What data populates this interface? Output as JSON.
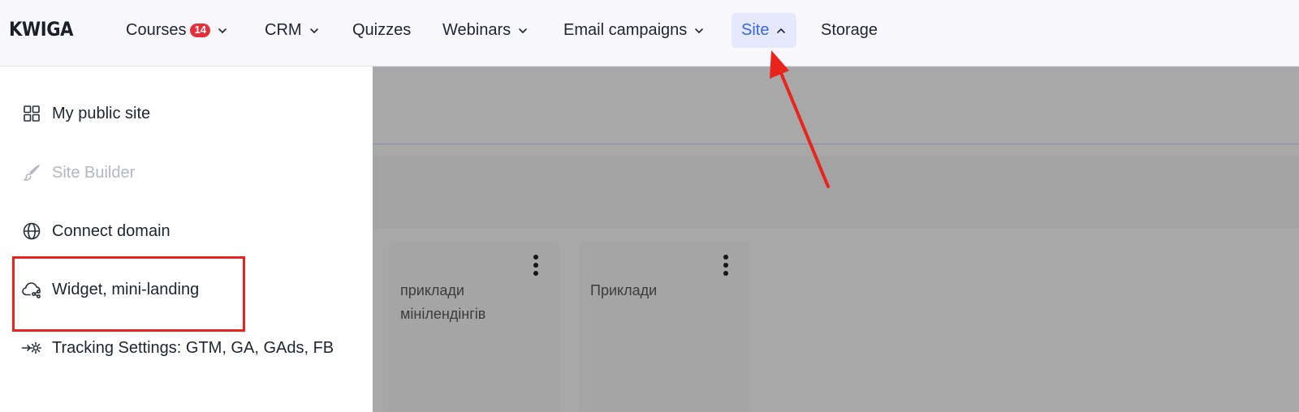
{
  "brand": {
    "logo_text": "KWIGA"
  },
  "nav": {
    "courses": {
      "label": "Courses",
      "badge": "14"
    },
    "crm": {
      "label": "CRM"
    },
    "quizzes": {
      "label": "Quizzes"
    },
    "webinars": {
      "label": "Webinars"
    },
    "email_campaigns": {
      "label": "Email campaigns"
    },
    "site": {
      "label": "Site",
      "active": true
    },
    "storage": {
      "label": "Storage"
    }
  },
  "site_menu": {
    "items": [
      {
        "label": "My public site",
        "icon": "grid-icon"
      },
      {
        "label": "Site Builder",
        "icon": "brush-icon",
        "disabled": true
      },
      {
        "label": "Connect domain",
        "icon": "globe-icon"
      },
      {
        "label": "Widget, mini-landing",
        "icon": "cloud-share-icon",
        "highlighted": true
      },
      {
        "label": "Tracking Settings: GTM, GA, GAds, FB",
        "icon": "arrow-gear-icon"
      }
    ]
  },
  "cards": [
    {
      "title": "приклади мінілендінгів"
    },
    {
      "title": "Приклади"
    }
  ],
  "colors": {
    "accent": "#3768e8",
    "active_tab_bg": "#e6e8fb",
    "badge": "#e5303b",
    "annotation_red": "#e8241c",
    "overlay": "#a8a8a8"
  }
}
